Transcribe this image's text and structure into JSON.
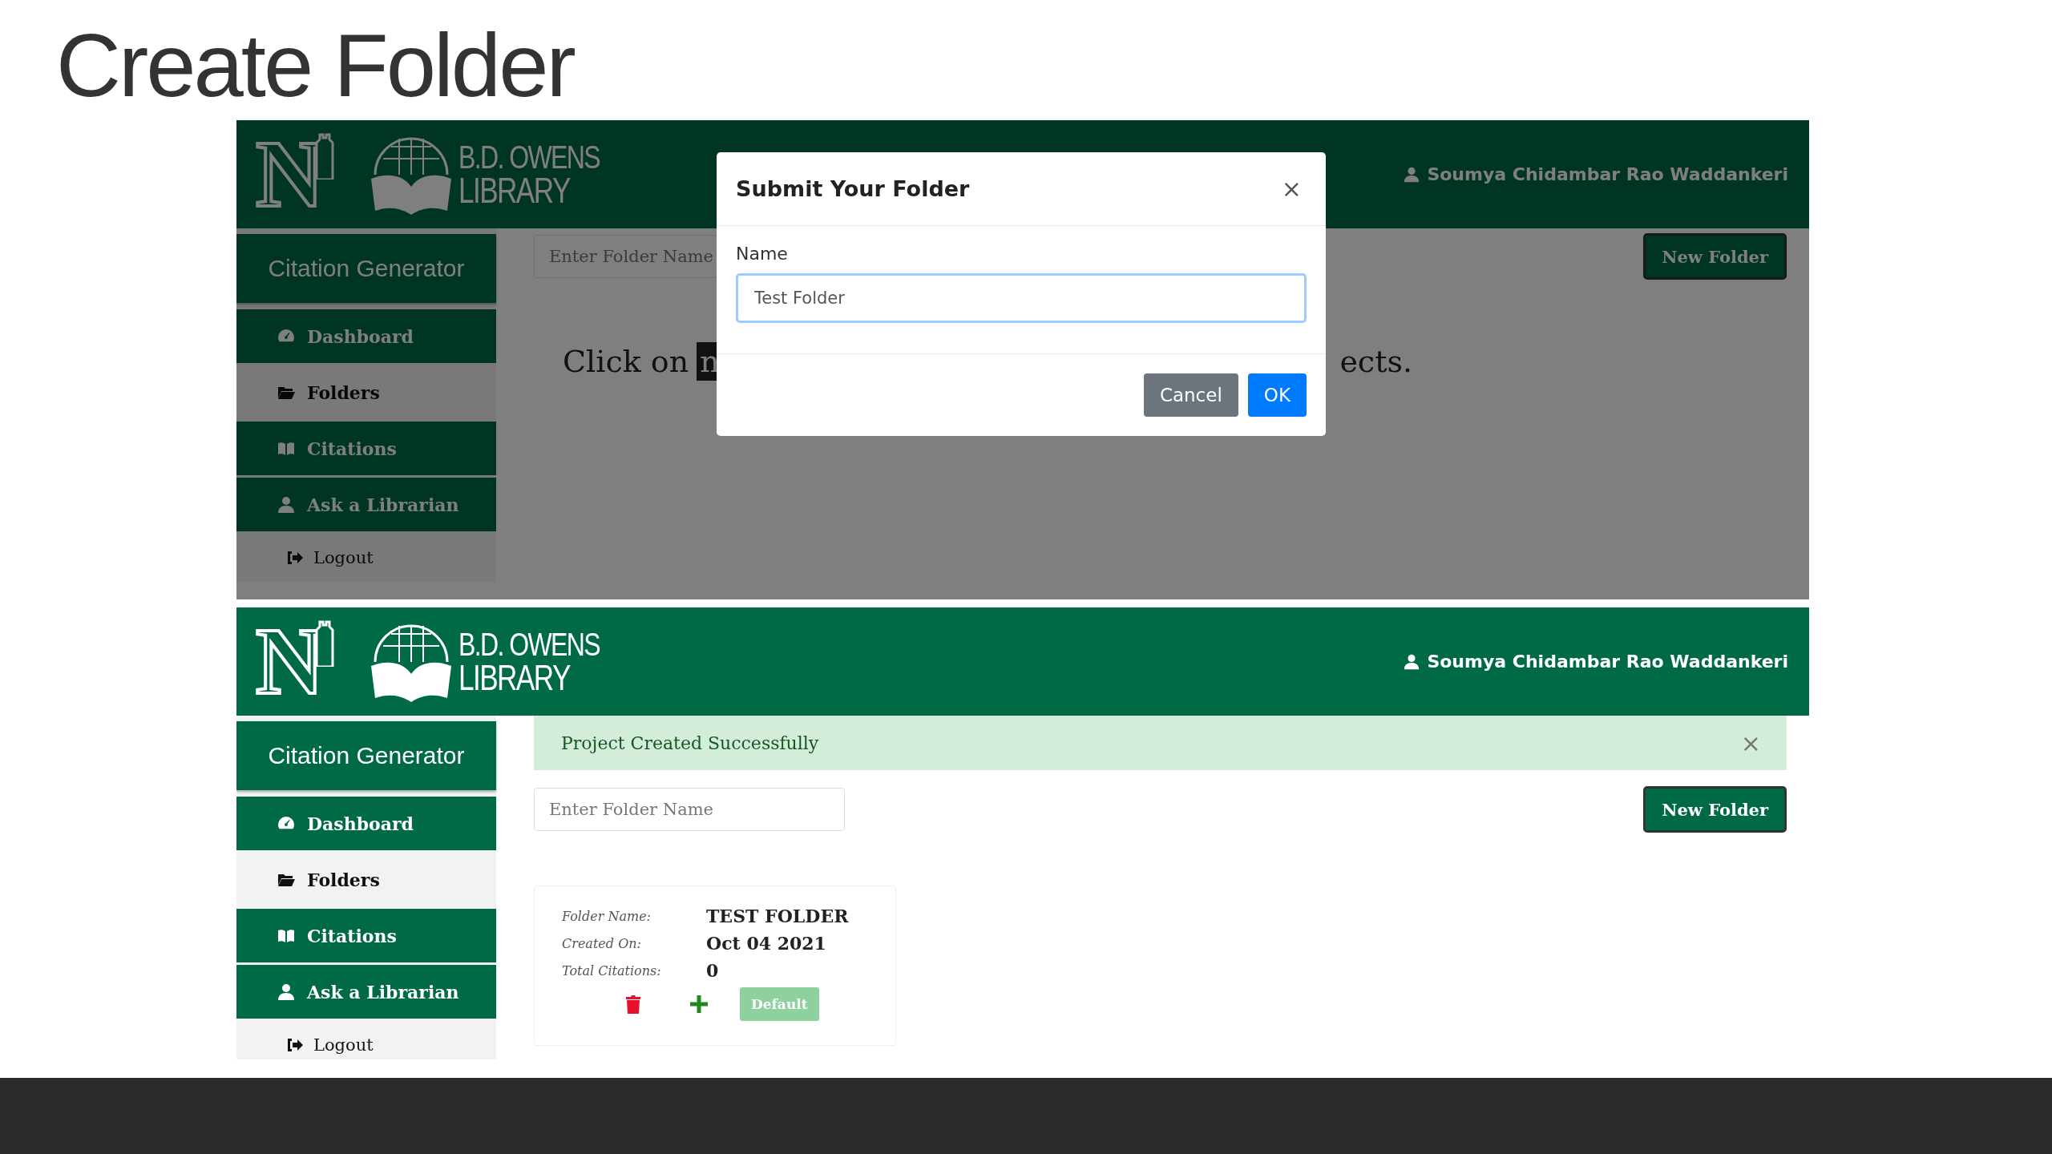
{
  "slide_title": "Create Folder",
  "screens": [
    {
      "header": {
        "emblem": "N",
        "logo_line1": "B.D. OWENS",
        "logo_line2": "LIBRARY",
        "user": "Soumya Chidambar Rao Waddankeri"
      },
      "sidebar": {
        "title": "Citation Generator",
        "items": [
          {
            "label": "Dashboard",
            "selected": false
          },
          {
            "label": "Folders",
            "selected": true
          },
          {
            "label": "Citations",
            "selected": false
          },
          {
            "label": "Ask a Librarian",
            "selected": false
          }
        ],
        "logout": "Logout"
      },
      "search": {
        "placeholder": "Enter Folder Name"
      },
      "new_button": "New Folder",
      "hint": {
        "before": "Click on",
        "badge": "n",
        "after": "ects."
      },
      "modal": {
        "title": "Submit Your Folder",
        "close": "×",
        "field_label": "Name",
        "value": "Test Folder",
        "buttons": [
          "Cancel",
          "OK"
        ]
      }
    },
    {
      "header": {
        "emblem": "N",
        "logo_line1": "B.D. OWENS",
        "logo_line2": "LIBRARY",
        "user": "Soumya Chidambar Rao Waddankeri"
      },
      "sidebar": {
        "title": "Citation Generator",
        "items": [
          {
            "label": "Dashboard",
            "selected": false
          },
          {
            "label": "Folders",
            "selected": true
          },
          {
            "label": "Citations",
            "selected": false
          },
          {
            "label": "Ask a Librarian",
            "selected": false
          }
        ],
        "logout": "Logout"
      },
      "alert": {
        "text": "Project Created Successfully",
        "close": "×"
      },
      "search": {
        "placeholder": "Enter Folder Name"
      },
      "new_button": "New Folder",
      "folder_card": {
        "rows": [
          {
            "label": "Folder Name:",
            "value": "TEST FOLDER"
          },
          {
            "label": "Created On:",
            "value": "Oct 04 2021"
          },
          {
            "label": "Total Citations:",
            "value": "0"
          }
        ],
        "default_button": "Default"
      }
    }
  ]
}
